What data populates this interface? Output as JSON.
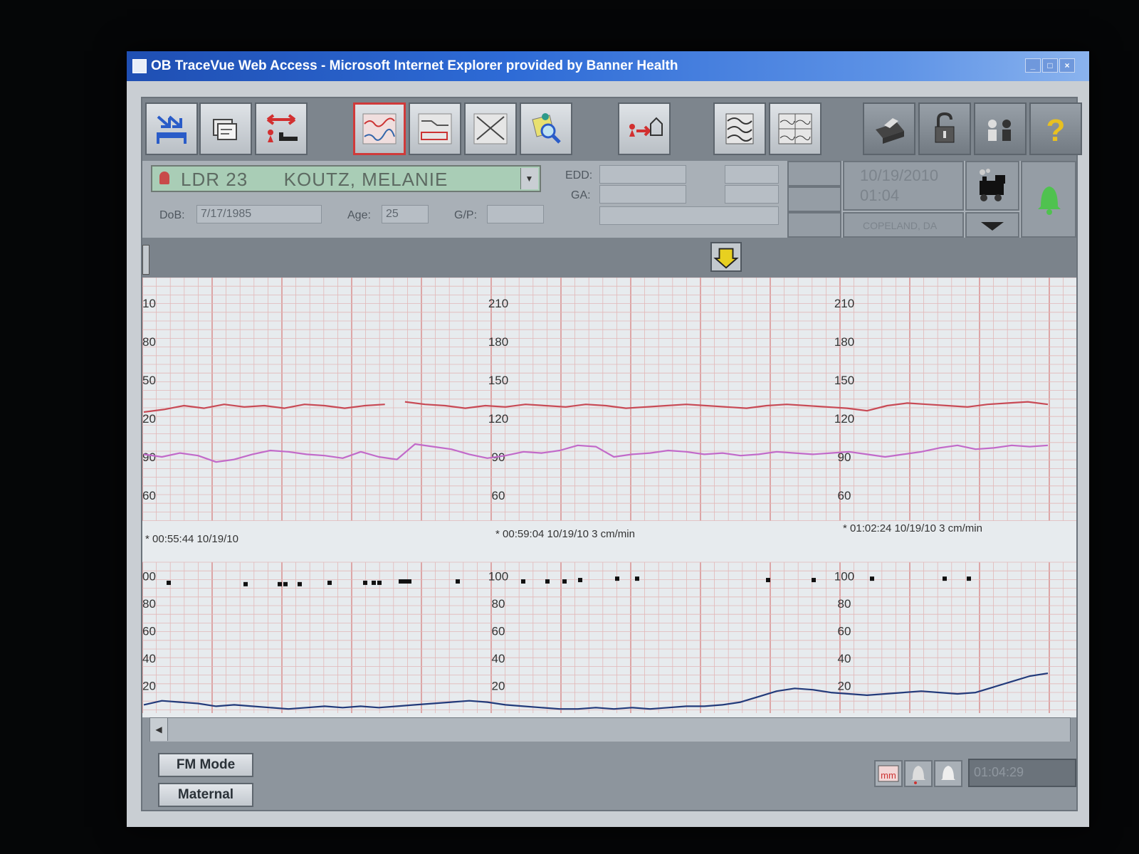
{
  "window": {
    "title": "OB TraceVue Web Access - Microsoft Internet Explorer provided by Banner Health"
  },
  "toolbar": {
    "buttons": [
      {
        "name": "admit-icon"
      },
      {
        "name": "documentation-icon"
      },
      {
        "name": "transfer-icon"
      },
      {
        "name": "trace-view-icon",
        "active": true
      },
      {
        "name": "trend-view-icon"
      },
      {
        "name": "graph-view-icon"
      },
      {
        "name": "search-icon"
      },
      {
        "name": "discharge-icon"
      },
      {
        "name": "overview-icon"
      },
      {
        "name": "split-view-icon"
      },
      {
        "name": "printer-icon"
      },
      {
        "name": "lock-icon"
      },
      {
        "name": "users-icon"
      },
      {
        "name": "help-icon"
      }
    ]
  },
  "patient": {
    "room": "LDR 23",
    "name": "KOUTZ, MELANIE",
    "dob_label": "DoB:",
    "dob": "7/17/1985",
    "age_label": "Age:",
    "age": "25",
    "gp_label": "G/P:",
    "gp": "",
    "edd_label": "EDD:",
    "ga_label": "GA:",
    "date": "10/19/2010",
    "time": "01:04",
    "clinician": "COPELAND, DA"
  },
  "chart_data": {
    "type": "line",
    "fhr_panel": {
      "ticks": [
        60,
        90,
        120,
        150,
        180,
        210
      ],
      "edge_ticks": [
        "10",
        "80",
        "50",
        "20",
        "90",
        "60"
      ],
      "ylim": [
        40,
        230
      ],
      "maternal_series_color": "#c84a55",
      "fetal_series_color": "#c26ac9",
      "maternal_series": [
        125,
        127,
        130,
        128,
        131,
        129,
        130,
        128,
        131,
        130,
        128,
        130,
        131,
        133,
        131,
        130,
        128,
        130,
        129,
        131,
        130,
        129,
        131,
        130,
        128,
        129,
        130,
        131,
        130,
        129,
        128,
        130,
        131,
        130,
        129,
        128,
        126,
        130,
        132,
        131,
        130,
        129,
        131,
        132,
        133,
        131
      ],
      "fetal_series": [
        92,
        90,
        93,
        91,
        86,
        88,
        92,
        95,
        94,
        92,
        91,
        89,
        94,
        90,
        88,
        100,
        98,
        96,
        92,
        89,
        91,
        94,
        93,
        95,
        99,
        98,
        90,
        92,
        93,
        95,
        94,
        92,
        93,
        91,
        92,
        94,
        93,
        92,
        93,
        94,
        92,
        90,
        92,
        94,
        97,
        99,
        96,
        97,
        99,
        98,
        99
      ],
      "time_labels": [
        "* 00:55:44 10/19/10",
        "* 00:59:04 10/19/10  3 cm/min",
        "* 01:02:24 10/19/10  3 cm/min"
      ]
    },
    "uc_panel": {
      "ticks": [
        20,
        40,
        60,
        80,
        100
      ],
      "edge_ticks": [
        "00",
        "80",
        "60",
        "40",
        "20"
      ],
      "ylim": [
        0,
        110
      ],
      "series_color": "#223a7a",
      "series": [
        6,
        9,
        8,
        7,
        5,
        6,
        5,
        4,
        3,
        4,
        5,
        4,
        5,
        4,
        5,
        6,
        7,
        8,
        9,
        8,
        6,
        5,
        4,
        3,
        3,
        4,
        3,
        4,
        3,
        4,
        5,
        5,
        6,
        8,
        12,
        16,
        18,
        17,
        15,
        14,
        13,
        14,
        15,
        16,
        15,
        14,
        15,
        19,
        23,
        27,
        29
      ],
      "markers": [
        95,
        94,
        94,
        94,
        94,
        95,
        95,
        95,
        95,
        96,
        96,
        96,
        96,
        96,
        96,
        96,
        97,
        98,
        98,
        97,
        97,
        98,
        98,
        98
      ]
    }
  },
  "bottom": {
    "fm_mode": "FM Mode",
    "maternal": "Maternal",
    "time_readout": "01:04:29"
  },
  "colors": {
    "grid_minor": "#e2b8b8",
    "grid_major": "#d99595",
    "alarm_green": "#4fc24f"
  }
}
